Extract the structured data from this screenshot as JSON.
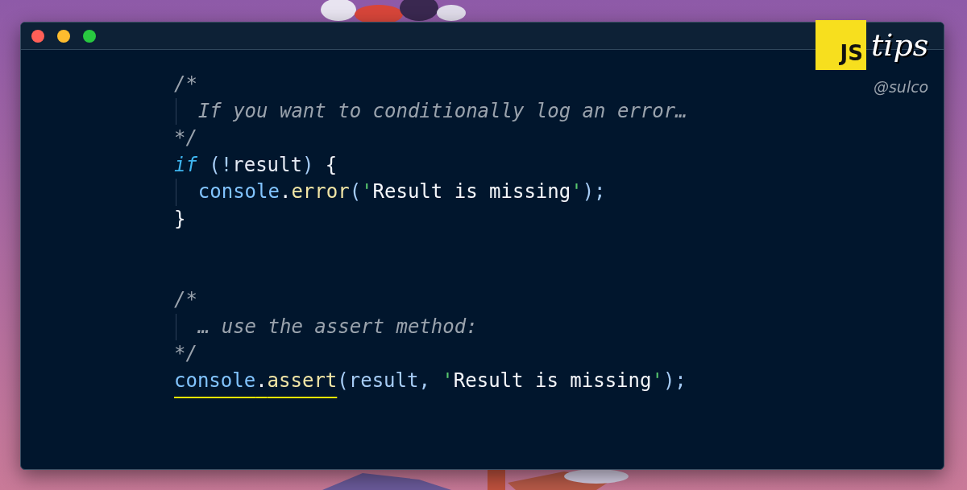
{
  "window": {
    "controls": [
      {
        "color": "#ff5f57"
      },
      {
        "color": "#febc2e"
      },
      {
        "color": "#28c840"
      }
    ]
  },
  "logo": {
    "badge": "JS",
    "word": "tips",
    "handle": "@sulco"
  },
  "code_blocks": [
    {
      "lines": [
        {
          "indented": false,
          "tokens": [
            {
              "kind": "comment",
              "text": "/*"
            }
          ]
        },
        {
          "indented": true,
          "tokens": [
            {
              "kind": "comment",
              "text": "If you want to conditionally log an error…"
            }
          ]
        },
        {
          "indented": false,
          "tokens": [
            {
              "kind": "comment",
              "text": "*/"
            }
          ]
        },
        {
          "indented": false,
          "tokens": [
            {
              "kind": "keyword",
              "text": "if"
            },
            {
              "kind": "punct",
              "text": " (!"
            },
            {
              "kind": "ident",
              "text": "result"
            },
            {
              "kind": "punct",
              "text": ")"
            },
            {
              "kind": "plain",
              "text": " {"
            }
          ]
        },
        {
          "indented": true,
          "tokens": [
            {
              "kind": "object",
              "text": "console"
            },
            {
              "kind": "plain",
              "text": "."
            },
            {
              "kind": "method",
              "text": "error"
            },
            {
              "kind": "punct",
              "text": "("
            },
            {
              "kind": "quote",
              "text": "'"
            },
            {
              "kind": "string",
              "text": "Result is missing"
            },
            {
              "kind": "quote",
              "text": "'"
            },
            {
              "kind": "punct",
              "text": ");"
            }
          ]
        },
        {
          "indented": false,
          "tokens": [
            {
              "kind": "plain",
              "text": "}"
            }
          ]
        }
      ]
    },
    {
      "lines": [
        {
          "indented": false,
          "tokens": [
            {
              "kind": "comment",
              "text": "/*"
            }
          ]
        },
        {
          "indented": true,
          "tokens": [
            {
              "kind": "comment",
              "text": "… use the assert method:"
            }
          ]
        },
        {
          "indented": false,
          "tokens": [
            {
              "kind": "comment",
              "text": "*/"
            }
          ]
        },
        {
          "indented": false,
          "tokens": [
            {
              "kind": "object",
              "text": "console",
              "underlined": true
            },
            {
              "kind": "plain",
              "text": ".",
              "underlined": true
            },
            {
              "kind": "method",
              "text": "assert",
              "underlined": true
            },
            {
              "kind": "punct",
              "text": "(result, "
            },
            {
              "kind": "quote",
              "text": "'"
            },
            {
              "kind": "string",
              "text": "Result is missing"
            },
            {
              "kind": "quote",
              "text": "'"
            },
            {
              "kind": "punct",
              "text": ");"
            }
          ]
        }
      ]
    }
  ]
}
